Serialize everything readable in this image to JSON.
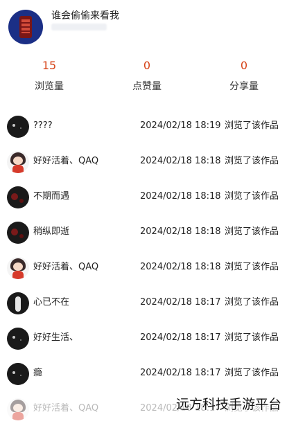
{
  "header": {
    "title": "谁会偷偷来看我"
  },
  "stats": [
    {
      "value": "15",
      "label": "浏览量"
    },
    {
      "value": "0",
      "label": "点赞量"
    },
    {
      "value": "0",
      "label": "分享量"
    }
  ],
  "colors": {
    "accent": "#d64318",
    "text": "#222222",
    "faded": "#b9b9b9"
  },
  "visitors": [
    {
      "name": "????",
      "time": "2024/02/18 18:19",
      "action": "浏览了该作品",
      "avatar": "dark-avatar-icon"
    },
    {
      "name": "好好活着、QAQ",
      "time": "2024/02/18 18:18",
      "action": "浏览了该作品",
      "avatar": "girl-avatar-icon"
    },
    {
      "name": "不期而遇",
      "time": "2024/02/18 18:18",
      "action": "浏览了该作品",
      "avatar": "red-splash-avatar-icon"
    },
    {
      "name": "稍纵即逝",
      "time": "2024/02/18 18:18",
      "action": "浏览了该作品",
      "avatar": "red-splash-avatar-icon"
    },
    {
      "name": "好好活着、QAQ",
      "time": "2024/02/18 18:18",
      "action": "浏览了该作品",
      "avatar": "girl-avatar-icon"
    },
    {
      "name": "心已不在",
      "time": "2024/02/18 18:17",
      "action": "浏览了该作品",
      "avatar": "silhouette-avatar-icon"
    },
    {
      "name": "好好生活、",
      "time": "2024/02/18 18:17",
      "action": "浏览了该作品",
      "avatar": "dark-avatar-icon"
    },
    {
      "name": "瘾",
      "time": "2024/02/18 18:17",
      "action": "浏览了该作品",
      "avatar": "dark-avatar-icon"
    },
    {
      "name": "好好活着、QAQ",
      "time": "2024/02/18 18:17",
      "action": "浏览了该作品",
      "avatar": "girl-avatar-icon"
    }
  ],
  "watermark": "远方科技手游平台"
}
